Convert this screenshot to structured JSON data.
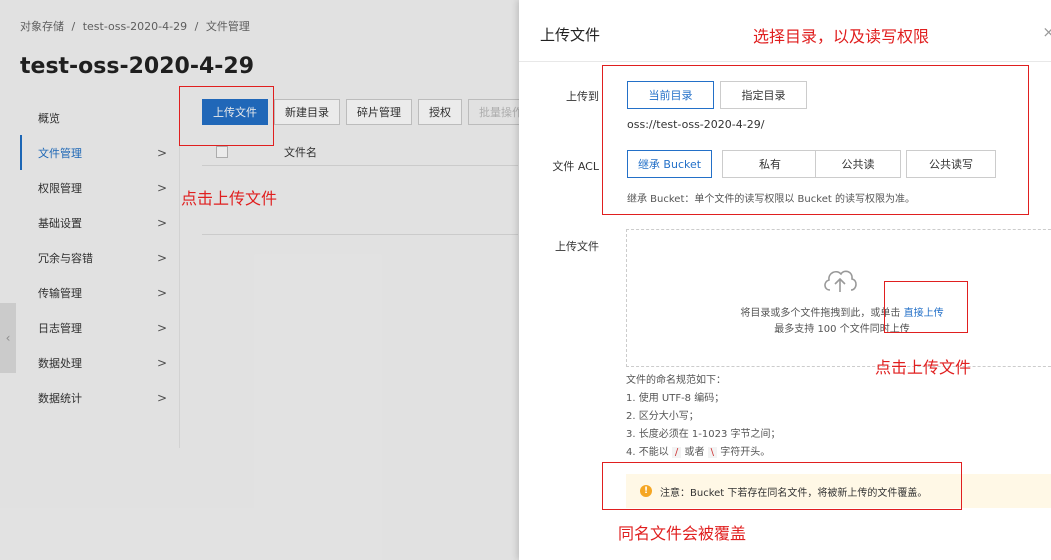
{
  "breadcrumb": [
    "对象存储",
    "/",
    "test-oss-2020-4-29",
    "/",
    "文件管理"
  ],
  "page_title": "test-oss-2020-4-29",
  "sidebar": {
    "items": [
      {
        "label": "概览",
        "chev": ""
      },
      {
        "label": "文件管理",
        "chev": ">"
      },
      {
        "label": "权限管理",
        "chev": ">"
      },
      {
        "label": "基础设置",
        "chev": ">"
      },
      {
        "label": "冗余与容错",
        "chev": ">"
      },
      {
        "label": "传输管理",
        "chev": ">"
      },
      {
        "label": "日志管理",
        "chev": ">"
      },
      {
        "label": "数据处理",
        "chev": ">"
      },
      {
        "label": "数据统计",
        "chev": ">"
      }
    ]
  },
  "toolbar": {
    "upload": "上传文件",
    "new_dir": "新建目录",
    "fragments": "碎片管理",
    "auth": "授权",
    "batch": "批量操作"
  },
  "table": {
    "col_name": "文件名"
  },
  "drawer": {
    "title": "上传文件",
    "close": "×",
    "upload_to_label": "上传到",
    "current_dir": "当前目录",
    "specified_dir": "指定目录",
    "path": "oss://test-oss-2020-4-29/",
    "acl_label": "文件 ACL",
    "acl_options": [
      "继承 Bucket",
      "私有",
      "公共读",
      "公共读写"
    ],
    "acl_hint": "继承 Bucket：单个文件的读写权限以 Bucket 的读写权限为准。",
    "file_label": "上传文件",
    "drop_text_before": "将目录或多个文件拖拽到此，或单击",
    "drop_link": "直接上传",
    "drop_limit": "最多支持 100 个文件同时上传",
    "rules_title": "文件的命名规范如下：",
    "rule1": "1. 使用 UTF-8 编码；",
    "rule2": "2. 区分大小写；",
    "rule3": "3. 长度必须在 1-1023 字节之间；",
    "rule4_a": "4. 不能以",
    "rule4_slash": "/",
    "rule4_or": "或者",
    "rule4_backslash": "\\",
    "rule4_b": "字符开头。",
    "notice": "注意：Bucket 下若存在同名文件，将被新上传的文件覆盖。"
  },
  "annotations": {
    "click_upload": "点击上传文件",
    "select_dir": "选择目录，以及读写权限",
    "click_upload2": "点击上传文件",
    "same_name": "同名文件会被覆盖"
  }
}
